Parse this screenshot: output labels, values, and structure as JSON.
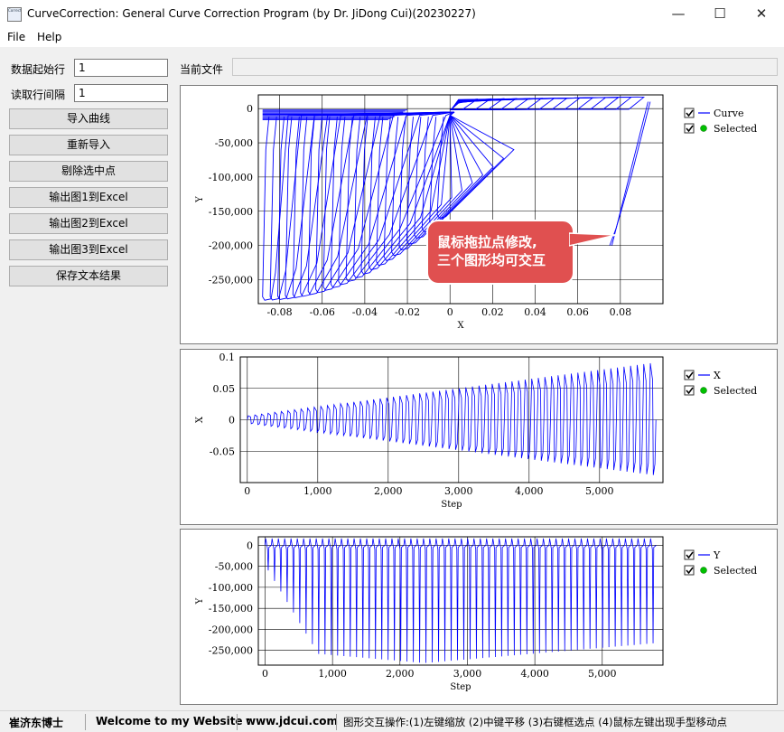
{
  "window": {
    "title": "CurveCorrection: General Curve Correction Program (by Dr. JiDong Cui)(20230227)",
    "icon_text": "Correct",
    "controls": {
      "minimize": "—",
      "maximize": "☐",
      "close": "✕"
    }
  },
  "menu": {
    "items": [
      "File",
      "Help"
    ]
  },
  "left": {
    "start_row_label": "数据起始行",
    "start_row_value": "1",
    "interval_label": "读取行间隔",
    "interval_value": "1",
    "buttons": [
      "导入曲线",
      "重新导入",
      "剔除选中点",
      "输出图1到Excel",
      "输出图2到Excel",
      "输出图3到Excel",
      "保存文本结果"
    ]
  },
  "current_file": {
    "label": "当前文件",
    "value": ""
  },
  "callout": {
    "text": "鼠标拖拉点修改,\n三个图形均可交互",
    "color": "#e05050"
  },
  "colors": {
    "curve": "#0000ff",
    "selected": "#00c000",
    "callout": "#e05050"
  },
  "chart_data": [
    {
      "type": "line",
      "xlabel": "X",
      "ylabel": "Y",
      "xlim": [
        -0.09,
        0.1
      ],
      "ylim": [
        -285000,
        20000
      ],
      "xticks": [
        -0.08,
        -0.06,
        -0.04,
        -0.02,
        0,
        0.02,
        0.04,
        0.06,
        0.08
      ],
      "xtick_labels": [
        "-0.08",
        "-0.06",
        "-0.04",
        "-0.02",
        "0",
        "0.02",
        "0.04",
        "0.06",
        "0.08"
      ],
      "yticks": [
        0,
        -50000,
        -100000,
        -150000,
        -200000,
        -250000
      ],
      "ytick_labels": [
        "0",
        "-50,000",
        "-100,000",
        "-150,000",
        "-200,000",
        "-250,000"
      ],
      "grid": true,
      "legend": {
        "position": "right",
        "entries": [
          {
            "name": "Curve",
            "checked": true
          },
          {
            "name": "Selected",
            "checked": true
          }
        ]
      },
      "series": [
        {
          "name": "Curve",
          "points": [
            [
              -0.088,
              0
            ],
            [
              -0.088,
              -280000
            ],
            [
              -0.082,
              -275000
            ],
            [
              -0.07,
              -268000
            ],
            [
              -0.06,
              -255000
            ],
            [
              -0.05,
              -240000
            ],
            [
              -0.04,
              -215000
            ],
            [
              -0.03,
              -190000
            ],
            [
              -0.02,
              -155000
            ],
            [
              -0.01,
              -100000
            ],
            [
              0,
              -40000
            ],
            [
              0.003,
              0
            ],
            [
              0.02,
              10000
            ],
            [
              0.04,
              14000
            ],
            [
              0.06,
              16000
            ],
            [
              0.08,
              16000
            ],
            [
              0.093,
              13000
            ],
            [
              0.094,
              10000
            ],
            [
              0.085,
              -100000
            ],
            [
              0.078,
              -175000
            ],
            [
              0.075,
              -200000
            ]
          ]
        }
      ]
    },
    {
      "type": "line",
      "xlabel": "Step",
      "ylabel": "X",
      "xlim": [
        -100,
        5900
      ],
      "ylim": [
        -0.1,
        0.1
      ],
      "xticks": [
        0,
        1000,
        2000,
        3000,
        4000,
        5000
      ],
      "xtick_labels": [
        "0",
        "1,000",
        "2,000",
        "3,000",
        "4,000",
        "5,000"
      ],
      "yticks": [
        0.1,
        0.05,
        0,
        -0.05
      ],
      "ytick_labels": [
        "0.1",
        "0.05",
        "0",
        "-0.05"
      ],
      "grid": true,
      "legend": {
        "position": "right",
        "entries": [
          {
            "name": "X",
            "checked": true
          },
          {
            "name": "Selected",
            "checked": true
          }
        ]
      },
      "series": [
        {
          "name": "X",
          "envelope_start_step": 0,
          "envelope_end_step": 5800,
          "max_amplitude_positive": 0.09,
          "max_amplitude_negative": -0.088,
          "cycles": 62
        }
      ]
    },
    {
      "type": "line",
      "xlabel": "Step",
      "ylabel": "Y",
      "xlim": [
        -100,
        5900
      ],
      "ylim": [
        -285000,
        20000
      ],
      "xticks": [
        0,
        1000,
        2000,
        3000,
        4000,
        5000
      ],
      "xtick_labels": [
        "0",
        "1,000",
        "2,000",
        "3,000",
        "4,000",
        "5,000"
      ],
      "yticks": [
        0,
        -50000,
        -100000,
        -150000,
        -200000,
        -250000
      ],
      "ytick_labels": [
        "0",
        "-50,000",
        "-100,000",
        "-150,000",
        "-200,000",
        "-250,000"
      ],
      "grid": true,
      "legend": {
        "position": "right",
        "entries": [
          {
            "name": "Y",
            "checked": true
          },
          {
            "name": "Selected",
            "checked": true
          }
        ]
      },
      "series": [
        {
          "name": "Y",
          "envelope_start_step": 0,
          "envelope_end_step": 5800,
          "max_positive": 20000,
          "min_negative": -280000,
          "cycles": 62
        }
      ]
    }
  ],
  "status": {
    "author": "崔济东博士",
    "welcome": "Welcome to my Website :",
    "website": "www.jdcui.com",
    "hint": "图形交互操作:(1)左键缩放 (2)中键平移 (3)右键框选点 (4)鼠标左键出现手型移动点"
  }
}
